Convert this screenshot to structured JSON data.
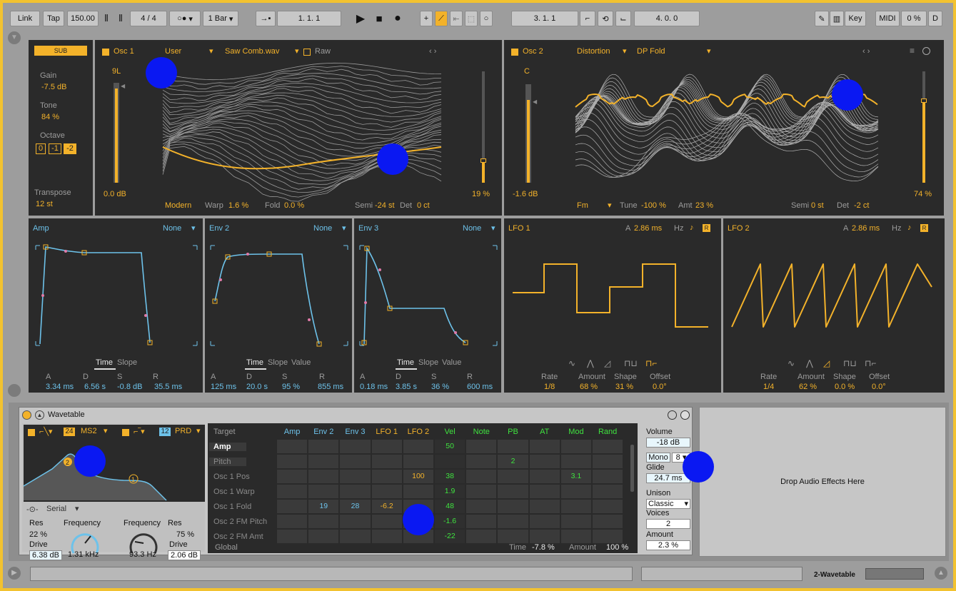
{
  "toolbar": {
    "link": "Link",
    "tap": "Tap",
    "tempo": "150.00",
    "sig_num": "4",
    "sig_sep": "/",
    "sig_den": "4",
    "metro": "○●",
    "bar": "1 Bar",
    "pos1": "1.   1.   1",
    "pos2": "3.   1.   1",
    "pos3": "4.   0.   0",
    "key": "Key",
    "midi": "MIDI",
    "cpu": "0 %",
    "d": "D"
  },
  "sub": {
    "label": "SUB",
    "gain_label": "Gain",
    "gain": "-7.5 dB",
    "tone_label": "Tone",
    "tone": "84 %",
    "octave_label": "Octave",
    "oct": [
      "0",
      "-1",
      "-2"
    ],
    "transpose_label": "Transpose",
    "transpose": "12 st"
  },
  "osc1": {
    "label": "Osc 1",
    "category": "User",
    "wavetable": "Saw Comb.wav",
    "raw": "Raw",
    "pos": "9L",
    "gain": "0.0 dB",
    "mode": "Modern",
    "warp_label": "Warp",
    "warp": "1.6 %",
    "fold_label": "Fold",
    "fold": "0.0 %",
    "semi_label": "Semi",
    "semi": "-24 st",
    "det_label": "Det",
    "det": "0 ct",
    "level": "19 %"
  },
  "osc2": {
    "label": "Osc 2",
    "category": "Distortion",
    "wavetable": "DP Fold",
    "pos": "C",
    "gain": "-1.6 dB",
    "fm": "Fm",
    "tune_label": "Tune",
    "tune": "-100 %",
    "amt_label": "Amt",
    "amt": "23 %",
    "semi_label": "Semi",
    "semi": "0 st",
    "det_label": "Det",
    "det": "-2 ct",
    "level": "74 %"
  },
  "envs": [
    {
      "name": "Amp",
      "src": "None",
      "tabs": [
        "Time",
        "Slope",
        ""
      ],
      "a": "3.34 ms",
      "d": "6.56 s",
      "s": "-0.8 dB",
      "r": "35.5 ms"
    },
    {
      "name": "Env 2",
      "src": "None",
      "tabs": [
        "Time",
        "Slope",
        "Value"
      ],
      "a": "125 ms",
      "d": "20.0 s",
      "s": "95 %",
      "r": "855 ms"
    },
    {
      "name": "Env 3",
      "src": "None",
      "tabs": [
        "Time",
        "Slope",
        "Value"
      ],
      "a": "0.18 ms",
      "d": "3.85 s",
      "s": "36 %",
      "r": "600 ms"
    }
  ],
  "adsr": [
    "A",
    "D",
    "S",
    "R"
  ],
  "lfos": [
    {
      "name": "LFO 1",
      "a_label": "A",
      "a": "2.86 ms",
      "hz": "Hz",
      "rate": "1/8",
      "amount": "68 %",
      "shape": "31 %",
      "offset": "0.0°"
    },
    {
      "name": "LFO 2",
      "a_label": "A",
      "a": "2.86 ms",
      "hz": "Hz",
      "rate": "1/4",
      "amount": "62 %",
      "shape": "0.0 %",
      "offset": "0.0°"
    }
  ],
  "lfo_labels": [
    "Rate",
    "Amount",
    "Shape",
    "Offset"
  ],
  "device": {
    "title": "Wavetable"
  },
  "filter": {
    "f1_slope": "24",
    "f1_type": "MS2",
    "f2_slope": "12",
    "f2_type": "PRD",
    "routing": "Serial",
    "res_label": "Res",
    "res1": "22 %",
    "freq_label": "Frequency",
    "freq1": "1.31 kHz",
    "drive_label": "Drive",
    "drive1": "6.38 dB",
    "freq2_label": "Frequency",
    "res2_label": "Res",
    "freq2": "93.3 Hz",
    "res2": "75 %",
    "drive2_label": "Drive",
    "drive2": "2.06 dB"
  },
  "matrix": {
    "target": "Target",
    "cols": [
      "Amp",
      "Env 2",
      "Env 3",
      "LFO 1",
      "LFO 2",
      "Vel",
      "Note",
      "PB",
      "AT",
      "Mod",
      "Rand"
    ],
    "rows": [
      "Amp",
      "Pitch",
      "Osc 1 Pos",
      "Osc 1 Warp",
      "Osc 1 Fold",
      "Osc 2 FM Pitch",
      "Osc 2 FM Amt"
    ],
    "values": {
      "amp_vel": "50",
      "pitch_pb": "2",
      "pos_lfo2": "100",
      "pos_vel": "38",
      "pos_mod": "3.1",
      "warp_vel": "1.9",
      "fold_env2": "19",
      "fold_env3": "28",
      "fold_lfo1": "-6.2",
      "fold_vel": "48",
      "fmp_vel": "-1.6",
      "fma_vel": "-22"
    },
    "global": "Global",
    "time_label": "Time",
    "time": "-7.8 %",
    "amount_label": "Amount",
    "amount": "100 %"
  },
  "global": {
    "volume_label": "Volume",
    "volume": "-18 dB",
    "mono": "Mono",
    "voices_n": "8",
    "glide_label": "Glide",
    "glide": "24.7 ms",
    "unison_label": "Unison",
    "unison": "Classic",
    "voices_label": "Voices",
    "voices": "2",
    "amount_label": "Amount",
    "amount": "2.3 %"
  },
  "drop": "Drop Audio Effects Here",
  "track": "2-Wavetable",
  "colors": {
    "orange": "#f3b22a",
    "cyan": "#6dc2ea",
    "green": "#3fe33f",
    "panel": "#2a2a2a",
    "border": "#f2c230"
  }
}
